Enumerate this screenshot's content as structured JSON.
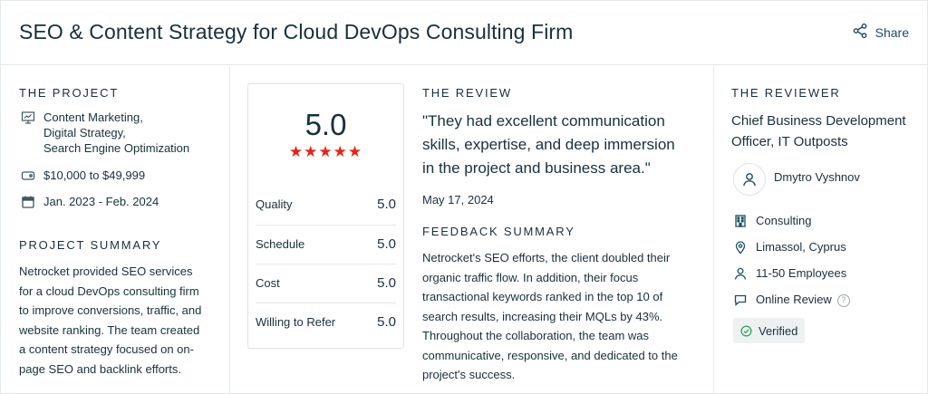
{
  "header": {
    "title": "SEO & Content Strategy for Cloud DevOps Consulting Firm",
    "share_label": "Share"
  },
  "project": {
    "label": "THE PROJECT",
    "services": [
      "Content Marketing,",
      "Digital Strategy,",
      "Search Engine Optimization"
    ],
    "budget": "$10,000 to $49,999",
    "dates": "Jan. 2023 - Feb. 2024",
    "icons": {
      "services": "presentation-icon",
      "budget": "price-tag-icon",
      "dates": "calendar-icon"
    }
  },
  "project_summary": {
    "label": "PROJECT SUMMARY",
    "lines": [
      "Netrocket provided SEO services",
      "for a cloud DevOps consulting firm",
      "to improve conversions, traffic, and",
      "website ranking. The team created",
      "a content strategy focused on on-",
      "page SEO and backlink efforts."
    ]
  },
  "rating": {
    "overall": "5.0",
    "stars": "★★★★★",
    "star_color": "#e62415",
    "metrics": [
      {
        "label": "Quality",
        "value": "5.0"
      },
      {
        "label": "Schedule",
        "value": "5.0"
      },
      {
        "label": "Cost",
        "value": "5.0"
      },
      {
        "label": "Willing to Refer",
        "value": "5.0"
      }
    ]
  },
  "review": {
    "label": "THE REVIEW",
    "quote_lines": [
      "\"They had excellent communication",
      "skills, expertise, and deep immersion",
      "in the project and business area.\""
    ],
    "date": "May 17, 2024",
    "feedback_label": "FEEDBACK SUMMARY",
    "feedback_lines": [
      "Netrocket's SEO efforts, the client doubled their",
      "organic traffic flow. In addition, their focus",
      "transactional keywords ranked in the top 10 of",
      "search results, increasing their MQLs by 43%.",
      "Throughout the collaboration, the team was",
      "communicative, responsive, and dedicated to the",
      "project's success."
    ]
  },
  "reviewer": {
    "label": "THE REVIEWER",
    "title_lines": [
      "Chief Business Development",
      "Officer, IT Outposts"
    ],
    "name": "Dmytro Vyshnov",
    "industry": "Consulting",
    "location": "Limassol, Cyprus",
    "size": "11-50 Employees",
    "review_type": "Online Review",
    "help_symbol": "?",
    "verified": "Verified",
    "icons": {
      "industry": "building-icon",
      "location": "location-pin-icon",
      "size": "user-icon",
      "review_type": "chat-bubble-icon",
      "verified": "check-circle-icon"
    }
  },
  "colors": {
    "text": "#17313b",
    "link": "#1b4c64",
    "border": "#e3e8eb",
    "verified_bg": "#eef1f2",
    "verified_check": "#2e9e5b"
  }
}
